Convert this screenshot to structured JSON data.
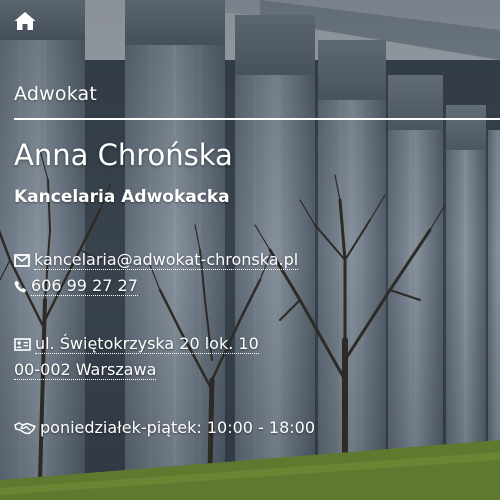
{
  "header": {
    "home_icon": "home-icon"
  },
  "profile": {
    "category": "Adwokat",
    "name": "Anna Chrońska",
    "office": "Kancelaria Adwokacka"
  },
  "contact": {
    "email_icon": "envelope-icon",
    "email": "kancelaria@adwokat-chronska.pl",
    "phone_icon": "phone-icon",
    "phone": "606 99 27 27",
    "address_icon": "address-card-icon",
    "address_line1": "ul. Świętokrzyska 20 lok. 10",
    "address_line2": "00-002 Warszawa",
    "hours_icon": "handshake-icon",
    "hours": "poniedziałek-piątek: 10:00 - 18:00"
  },
  "colors": {
    "text": "#ffffff",
    "sky": "#b9c1c9",
    "columns": "#8a96a2",
    "grass": "#5d7a2e"
  }
}
